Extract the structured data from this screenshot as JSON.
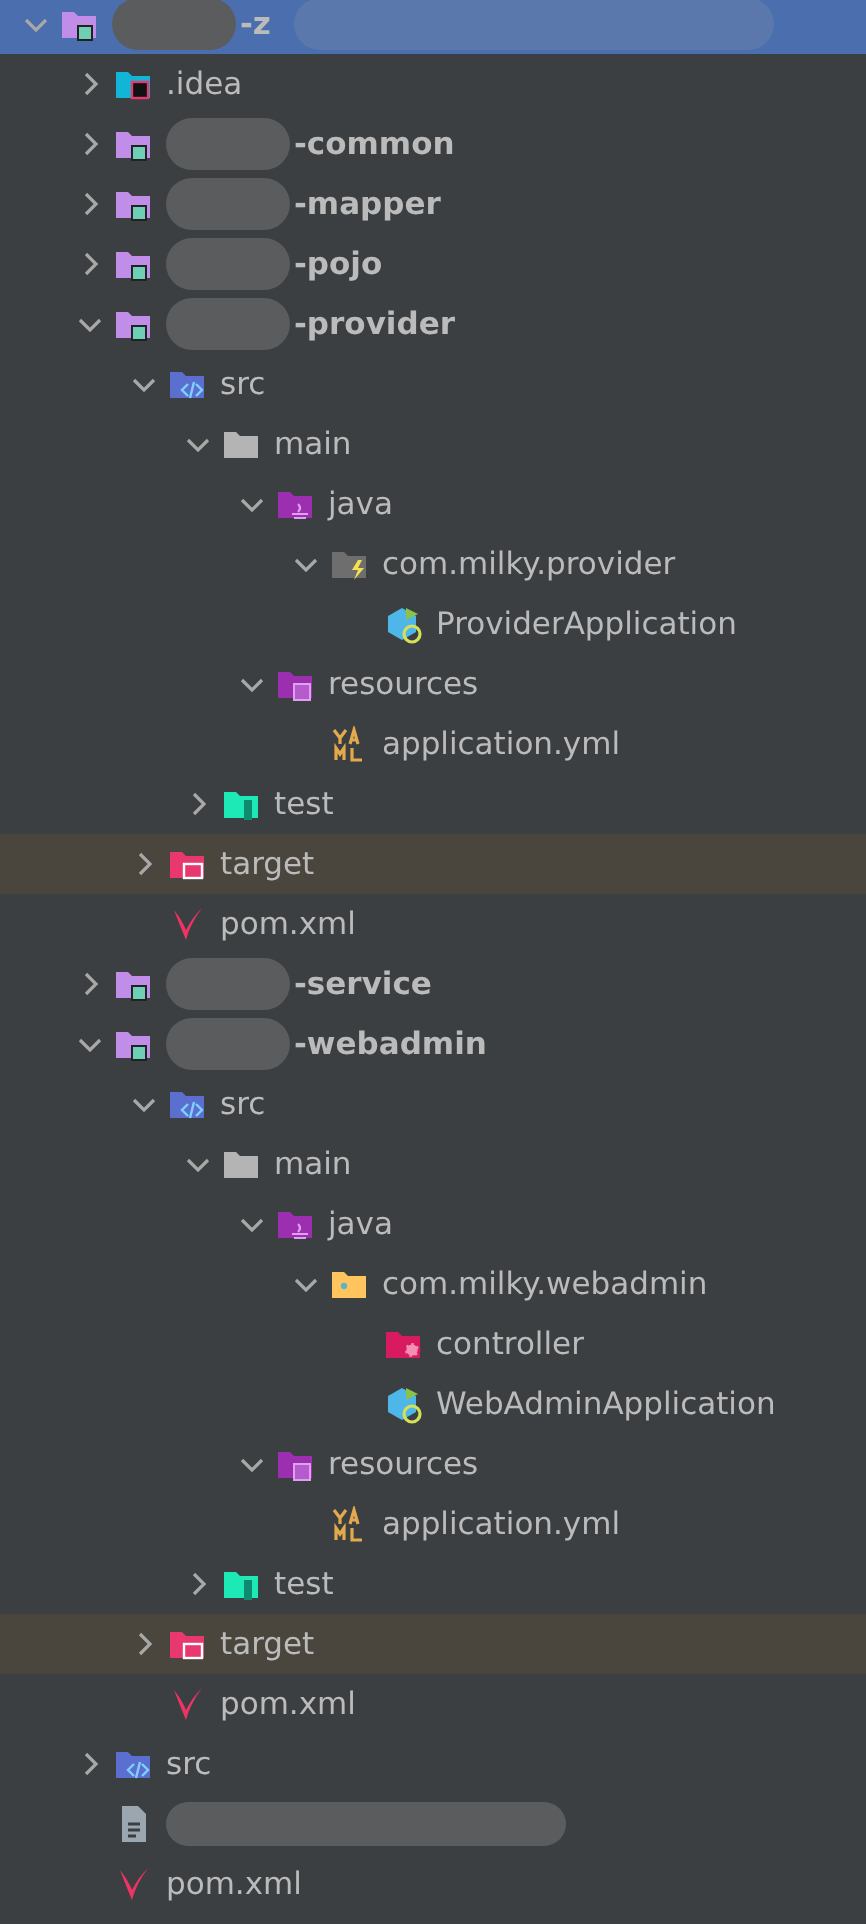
{
  "tree": [
    {
      "label": "-z",
      "kind": "module",
      "expanded": true,
      "selected": true,
      "redacted": true,
      "children": [
        {
          "label": ".idea",
          "kind": "idea-folder",
          "expanded": false,
          "selected": false
        },
        {
          "label": "-common",
          "kind": "module",
          "expanded": false,
          "selected": false,
          "redacted": true
        },
        {
          "label": "-mapper",
          "kind": "module",
          "expanded": false,
          "selected": false,
          "redacted": true
        },
        {
          "label": "-pojo",
          "kind": "module",
          "expanded": false,
          "selected": false,
          "redacted": true
        },
        {
          "label": "-provider",
          "kind": "module",
          "expanded": true,
          "selected": false,
          "redacted": true,
          "children": [
            {
              "label": "src",
              "kind": "source-folder",
              "expanded": true,
              "selected": false,
              "children": [
                {
                  "label": "main",
                  "kind": "folder",
                  "expanded": true,
                  "selected": false,
                  "children": [
                    {
                      "label": "java",
                      "kind": "java-folder",
                      "expanded": true,
                      "selected": false,
                      "children": [
                        {
                          "label": "com.milky.provider",
                          "kind": "config-package",
                          "expanded": true,
                          "selected": false,
                          "children": [
                            {
                              "label": "ProviderApplication",
                              "kind": "spring-class",
                              "selected": false
                            }
                          ]
                        }
                      ]
                    },
                    {
                      "label": "resources",
                      "kind": "resources-folder",
                      "expanded": true,
                      "selected": false,
                      "children": [
                        {
                          "label": "application.yml",
                          "kind": "yaml",
                          "selected": false
                        }
                      ]
                    }
                  ]
                },
                {
                  "label": "test",
                  "kind": "test-folder",
                  "expanded": false,
                  "selected": false
                }
              ]
            },
            {
              "label": "target",
              "kind": "target-folder",
              "expanded": false,
              "selected": false,
              "excluded": true
            },
            {
              "label": "pom.xml",
              "kind": "maven",
              "selected": false
            }
          ]
        },
        {
          "label": "-service",
          "kind": "module",
          "expanded": false,
          "selected": false,
          "redacted": true
        },
        {
          "label": "-webadmin",
          "kind": "module",
          "expanded": true,
          "selected": false,
          "redacted": true,
          "children": [
            {
              "label": "src",
              "kind": "source-folder",
              "expanded": true,
              "selected": false,
              "children": [
                {
                  "label": "main",
                  "kind": "folder",
                  "expanded": true,
                  "selected": false,
                  "children": [
                    {
                      "label": "java",
                      "kind": "java-folder",
                      "expanded": true,
                      "selected": false,
                      "children": [
                        {
                          "label": "com.milky.webadmin",
                          "kind": "package",
                          "expanded": true,
                          "selected": false,
                          "children": [
                            {
                              "label": "controller",
                              "kind": "controller-folder",
                              "selected": false
                            },
                            {
                              "label": "WebAdminApplication",
                              "kind": "spring-class",
                              "selected": false
                            }
                          ]
                        }
                      ]
                    },
                    {
                      "label": "resources",
                      "kind": "resources-folder",
                      "expanded": true,
                      "selected": false,
                      "children": [
                        {
                          "label": "application.yml",
                          "kind": "yaml",
                          "selected": false
                        }
                      ]
                    }
                  ]
                },
                {
                  "label": "test",
                  "kind": "test-folder",
                  "expanded": false,
                  "selected": false
                }
              ]
            },
            {
              "label": "target",
              "kind": "target-folder",
              "expanded": false,
              "selected": false,
              "excluded": true
            },
            {
              "label": "pom.xml",
              "kind": "maven",
              "selected": false
            }
          ]
        },
        {
          "label": "src",
          "kind": "source-folder",
          "expanded": false,
          "selected": false
        },
        {
          "kind": "text-file",
          "selected": false,
          "redacted": true
        },
        {
          "label": "pom.xml",
          "kind": "maven",
          "selected": false
        }
      ]
    }
  ]
}
